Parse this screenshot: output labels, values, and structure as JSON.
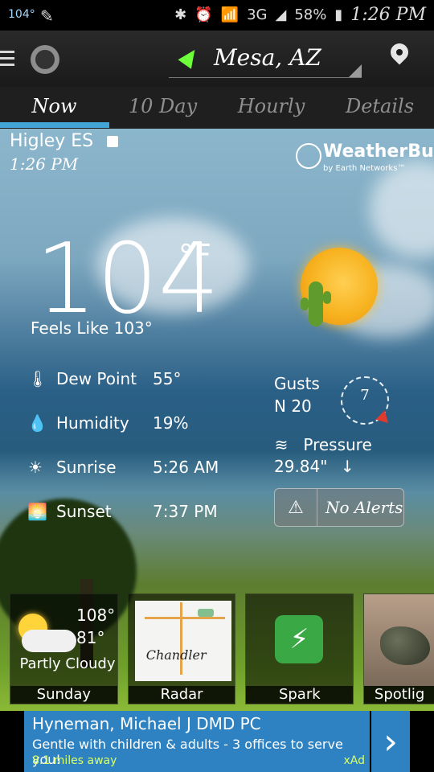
{
  "status_bar": {
    "temp": "104°",
    "battery": "58%",
    "network": "3G",
    "time": "1:26 PM"
  },
  "app_bar": {
    "location": "Mesa, AZ"
  },
  "tabs": [
    {
      "label": "Now"
    },
    {
      "label": "10 Day"
    },
    {
      "label": "Hourly"
    },
    {
      "label": "Details"
    }
  ],
  "current": {
    "station": "Higley ES",
    "time": "1:26 PM",
    "brand_name": "WeatherBug",
    "brand_sub": "by Earth Networks™",
    "temp": "104",
    "unit": "°F",
    "feels_like_label": "Feels Like",
    "feels_like_value": "103°",
    "dew_point_label": "Dew Point",
    "dew_point_value": "55°",
    "humidity_label": "Humidity",
    "humidity_value": "19%",
    "sunrise_label": "Sunrise",
    "sunrise_value": "5:26 AM",
    "sunset_label": "Sunset",
    "sunset_value": "7:37 PM",
    "gusts_label": "Gusts",
    "gusts_value": "N 20",
    "compass_value": "7",
    "pressure_label": "Pressure",
    "pressure_value": "29.84\"",
    "alerts_text": "No Alerts"
  },
  "cards": {
    "forecast": {
      "high": "108°",
      "low": "81°",
      "condition": "Partly Cloudy",
      "day": "Sunday"
    },
    "radar": {
      "map_label": "Chandler",
      "title": "Radar"
    },
    "spark": {
      "title": "Spark"
    },
    "spotlight": {
      "title": "Spotlig"
    }
  },
  "ad": {
    "title": "Hyneman, Michael J DMD PC",
    "subtitle": "Gentle with children & adults - 3 offices to serve you!",
    "distance": "8.1 miles away",
    "tag": "xAd"
  }
}
